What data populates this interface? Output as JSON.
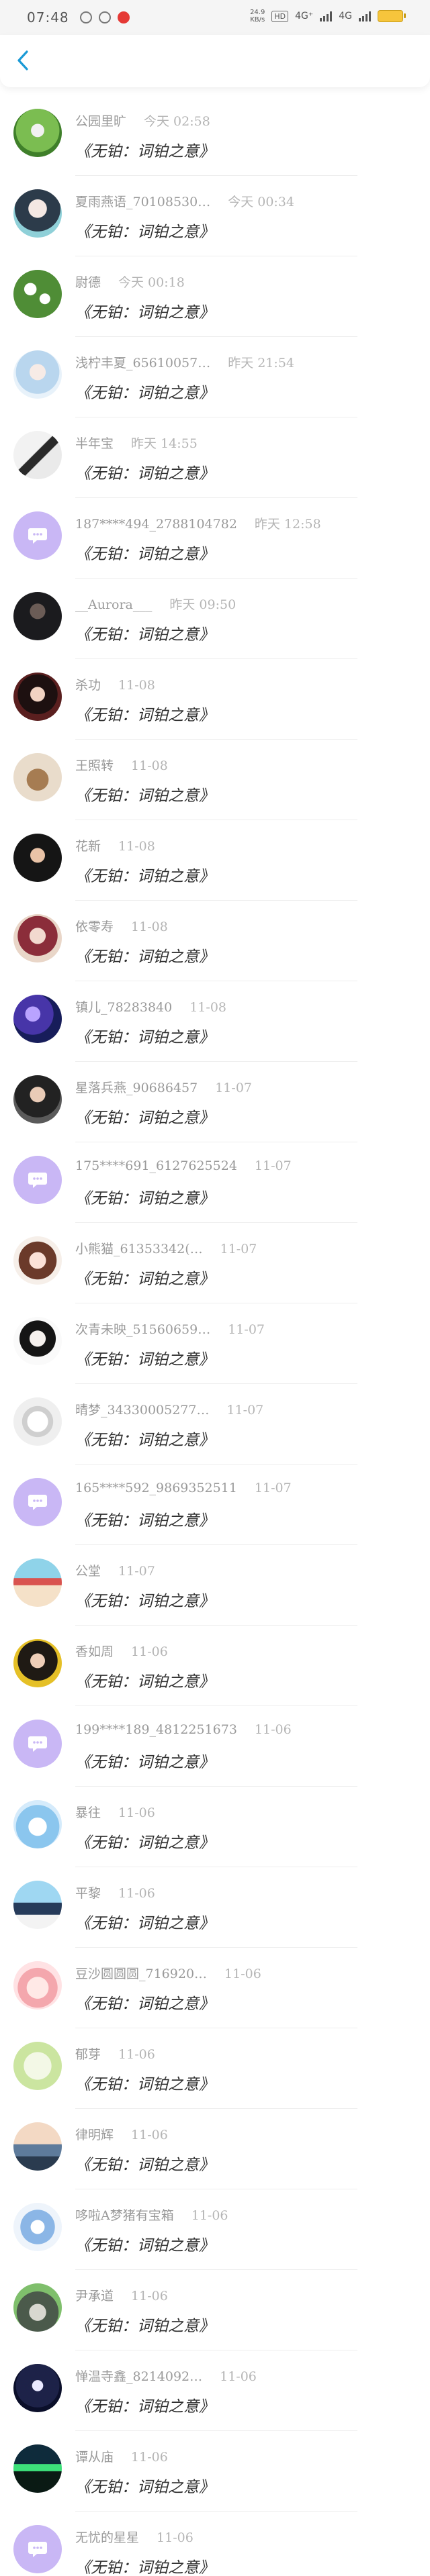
{
  "status_bar": {
    "time": "07:48",
    "speed_top": "24.9",
    "speed_bottom": "KB/s",
    "hd": "HD",
    "net1": "4G⁺",
    "net2": "4G"
  },
  "colors": {
    "accent": "#1a9ad6",
    "default_avatar": "#c9b7f5"
  },
  "list": [
    {
      "name": "公园里旷",
      "time": "今天 02:58",
      "message": "《无铂：词铂之意》",
      "avatar": "flower-green"
    },
    {
      "name": "夏雨燕语_70108530…",
      "time": "今天 00:34",
      "message": "《无铂：词铂之意》",
      "avatar": "anime-girl-teal"
    },
    {
      "name": "尉德",
      "time": "今天 00:18",
      "message": "《无铂：词铂之意》",
      "avatar": "flower-white"
    },
    {
      "name": "浅柠丰夏_65610057…",
      "time": "昨天 21:54",
      "message": "《无铂：词铂之意》",
      "avatar": "anime-girl-blue"
    },
    {
      "name": "半年宝",
      "time": "昨天 14:55",
      "message": "《无铂：词铂之意》",
      "avatar": "ink-figure"
    },
    {
      "name": "187****494_2788104782",
      "time": "昨天 12:58",
      "message": "《无铂：词铂之意》",
      "avatar": "default"
    },
    {
      "name": "__Aurora___",
      "time": "昨天 09:50",
      "message": "《无铂：词铂之意》",
      "avatar": "dark-portrait"
    },
    {
      "name": "杀功",
      "time": "11-08",
      "message": "《无铂：词铂之意》",
      "avatar": "girl-red"
    },
    {
      "name": "王照转",
      "time": "11-08",
      "message": "《无铂：词铂之意》",
      "avatar": "bear"
    },
    {
      "name": "花新",
      "time": "11-08",
      "message": "《无铂：词铂之意》",
      "avatar": "girl-dark"
    },
    {
      "name": "依零寿",
      "time": "11-08",
      "message": "《无铂：词铂之意》",
      "avatar": "doll"
    },
    {
      "name": "镇儿_78283840",
      "time": "11-08",
      "message": "《无铂：词铂之意》",
      "avatar": "purple-flowers"
    },
    {
      "name": "星落兵燕_90686457",
      "time": "11-07",
      "message": "《无铂：词铂之意》",
      "avatar": "portrait-dark"
    },
    {
      "name": "175****691_6127625524",
      "time": "11-07",
      "message": "《无铂：词铂之意》",
      "avatar": "default"
    },
    {
      "name": "小熊猫_61353342(…",
      "time": "11-07",
      "message": "《无铂：词铂之意》",
      "avatar": "anime-chibi"
    },
    {
      "name": "次青未映_51560659…",
      "time": "11-07",
      "message": "《无铂：词铂之意》",
      "avatar": "ink-boy"
    },
    {
      "name": "晴梦_34330005277…",
      "time": "11-07",
      "message": "《无铂：词铂之意》",
      "avatar": "sketch"
    },
    {
      "name": "165****592_9869352511",
      "time": "11-07",
      "message": "《无铂：词铂之意》",
      "avatar": "default"
    },
    {
      "name": "公堂",
      "time": "11-07",
      "message": "《无铂：词铂之意》",
      "avatar": "house"
    },
    {
      "name": "香如周",
      "time": "11-06",
      "message": "《无铂：词铂之意》",
      "avatar": "girl-yellow"
    },
    {
      "name": "199****189_4812251673",
      "time": "11-06",
      "message": "《无铂：词铂之意》",
      "avatar": "default"
    },
    {
      "name": "暴往",
      "time": "11-06",
      "message": "《无铂：词铂之意》",
      "avatar": "sky-anime"
    },
    {
      "name": "平黎",
      "time": "11-06",
      "message": "《无铂：词铂之意》",
      "avatar": "mountain-girl"
    },
    {
      "name": "豆沙圆圆圆_716920…",
      "time": "11-06",
      "message": "《无铂：词铂之意》",
      "avatar": "pink-chibi"
    },
    {
      "name": "郁芽",
      "time": "11-06",
      "message": "《无铂：词铂之意》",
      "avatar": "green-doodle"
    },
    {
      "name": "律明辉",
      "time": "11-06",
      "message": "《无铂：词铂之意》",
      "avatar": "city"
    },
    {
      "name": "哆啦A梦猪有宝箱",
      "time": "11-06",
      "message": "《无铂：词铂之意》",
      "avatar": "blue-cartoon"
    },
    {
      "name": "尹承道",
      "time": "11-06",
      "message": "《无铂：词铂之意》",
      "avatar": "totoro"
    },
    {
      "name": "惮温寺鑫_8214092…",
      "time": "11-06",
      "message": "《无铂：词铂之意》",
      "avatar": "night-girl"
    },
    {
      "name": "谭从庙",
      "time": "11-06",
      "message": "《无铂：词铂之意》",
      "avatar": "aurora"
    },
    {
      "name": "无忧的星星",
      "time": "11-06",
      "message": "《无铂：词铂之意》",
      "avatar": "default"
    }
  ]
}
